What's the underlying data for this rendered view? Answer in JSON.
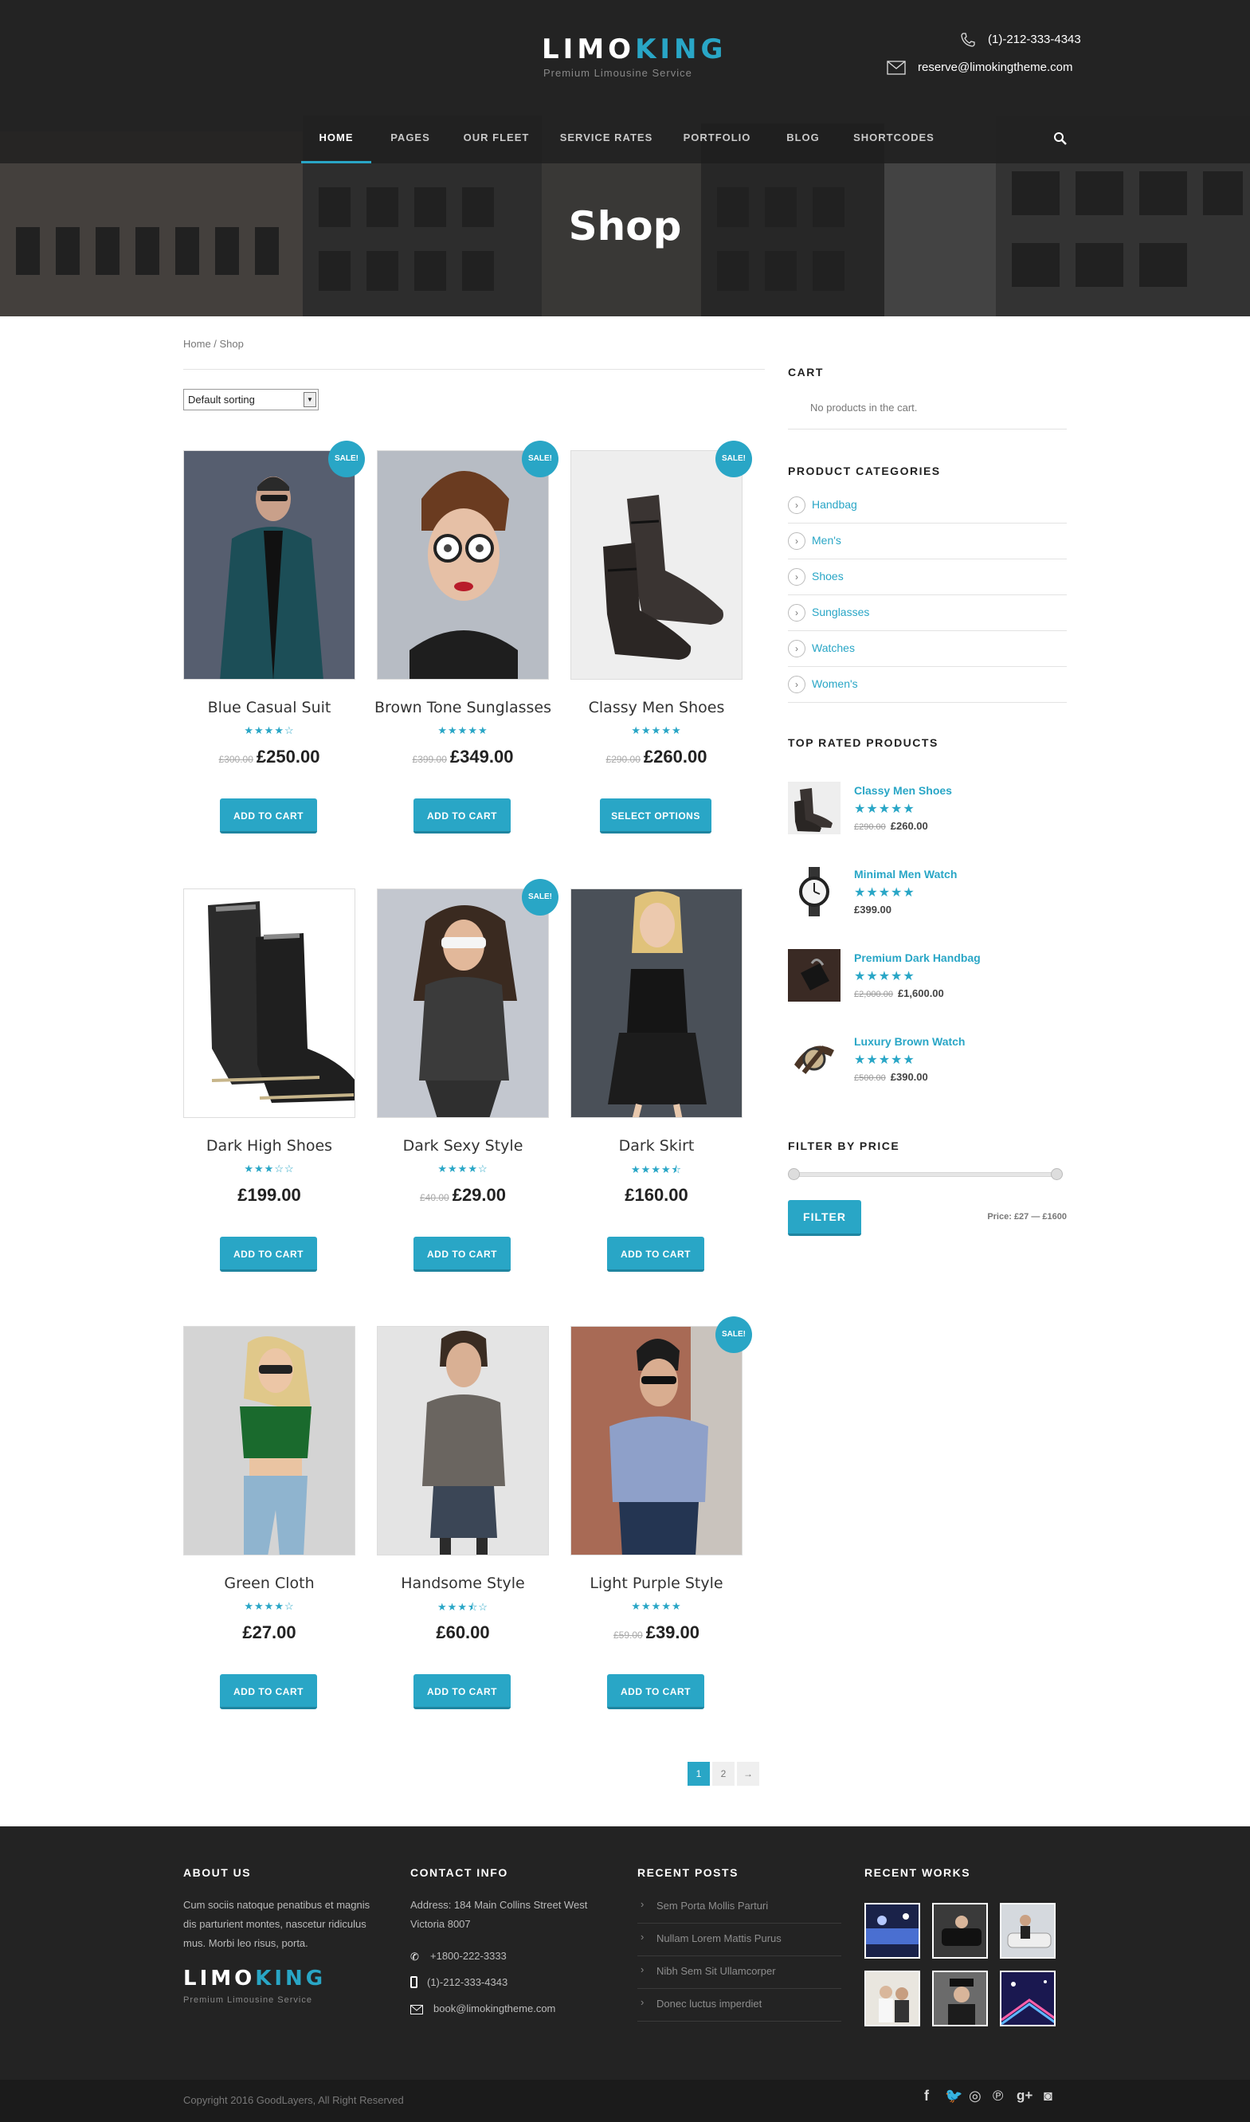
{
  "header": {
    "logo_main": "LIMO",
    "logo_accent": "KING",
    "logo_sub": "Premium Limousine Service",
    "phone": "(1)-212-333-4343",
    "email": "reserve@limokingtheme.com"
  },
  "nav": {
    "items": [
      "HOME",
      "PAGES",
      "OUR FLEET",
      "SERVICE RATES",
      "PORTFOLIO",
      "BLOG",
      "SHORTCODES"
    ],
    "active": "HOME"
  },
  "hero": {
    "title": "Shop"
  },
  "breadcrumb": "Home / Shop",
  "sorting": {
    "selected": "Default sorting"
  },
  "sale_label": "SALE!",
  "products": [
    {
      "name": "Blue Casual Suit",
      "rating": 4,
      "old_price": "£300.00",
      "price": "£250.00",
      "button": "ADD TO CART",
      "sale": true
    },
    {
      "name": "Brown Tone Sunglasses",
      "rating": 5,
      "old_price": "£399.00",
      "price": "£349.00",
      "button": "ADD TO CART",
      "sale": true
    },
    {
      "name": "Classy Men Shoes",
      "rating": 5,
      "old_price": "£290.00",
      "price": "£260.00",
      "button": "SELECT OPTIONS",
      "sale": true
    },
    {
      "name": "Dark High Shoes",
      "rating": 3,
      "old_price": "",
      "price": "£199.00",
      "button": "ADD TO CART",
      "sale": false
    },
    {
      "name": "Dark Sexy Style",
      "rating": 4,
      "old_price": "£40.00",
      "price": "£29.00",
      "button": "ADD TO CART",
      "sale": true
    },
    {
      "name": "Dark Skirt",
      "rating": 4.5,
      "old_price": "",
      "price": "£160.00",
      "button": "ADD TO CART",
      "sale": false
    },
    {
      "name": "Green Cloth",
      "rating": 4,
      "old_price": "",
      "price": "£27.00",
      "button": "ADD TO CART",
      "sale": false
    },
    {
      "name": "Handsome Style",
      "rating": 3.5,
      "old_price": "",
      "price": "£60.00",
      "button": "ADD TO CART",
      "sale": false
    },
    {
      "name": "Light Purple Style",
      "rating": 5,
      "old_price": "£59.00",
      "price": "£39.00",
      "button": "ADD TO CART",
      "sale": true
    }
  ],
  "pagination": {
    "pages": [
      "1",
      "2"
    ],
    "current": "1",
    "next": "→"
  },
  "sidebar": {
    "cart_title": "CART",
    "cart_empty": "No products in the cart.",
    "categories_title": "PRODUCT CATEGORIES",
    "categories": [
      "Handbag",
      "Men's",
      "Shoes",
      "Sunglasses",
      "Watches",
      "Women's"
    ],
    "top_rated_title": "TOP RATED PRODUCTS",
    "top_rated": [
      {
        "name": "Classy Men Shoes",
        "old_price": "£290.00",
        "price": "£260.00"
      },
      {
        "name": "Minimal Men Watch",
        "old_price": "",
        "price": "£399.00"
      },
      {
        "name": "Premium Dark Handbag",
        "old_price": "£2,000.00",
        "price": "£1,600.00"
      },
      {
        "name": "Luxury Brown Watch",
        "old_price": "£500.00",
        "price": "£390.00"
      }
    ],
    "filter_title": "FILTER BY PRICE",
    "filter_button": "FILTER",
    "price_range": "Price: £27 — £1600"
  },
  "footer": {
    "about_title": "ABOUT US",
    "about_text": "Cum sociis natoque penatibus et magnis dis parturient montes, nascetur ridiculus mus. Morbi leo risus, porta.",
    "contact_title": "CONTACT INFO",
    "address": "Address: 184 Main Collins Street West Victoria 8007",
    "phone1": "+1800-222-3333",
    "phone2": "(1)-212-333-4343",
    "email": "book@limokingtheme.com",
    "posts_title": "RECENT POSTS",
    "posts": [
      "Sem Porta Mollis Parturi",
      "Nullam Lorem Mattis Purus",
      "Nibh Sem Sit Ullamcorper",
      "Donec luctus imperdiet"
    ],
    "works_title": "RECENT WORKS",
    "copyright": "Copyright 2016 GoodLayers, All Right Reserved"
  },
  "colors": {
    "accent": "#29a6c6",
    "dark": "#232323"
  }
}
